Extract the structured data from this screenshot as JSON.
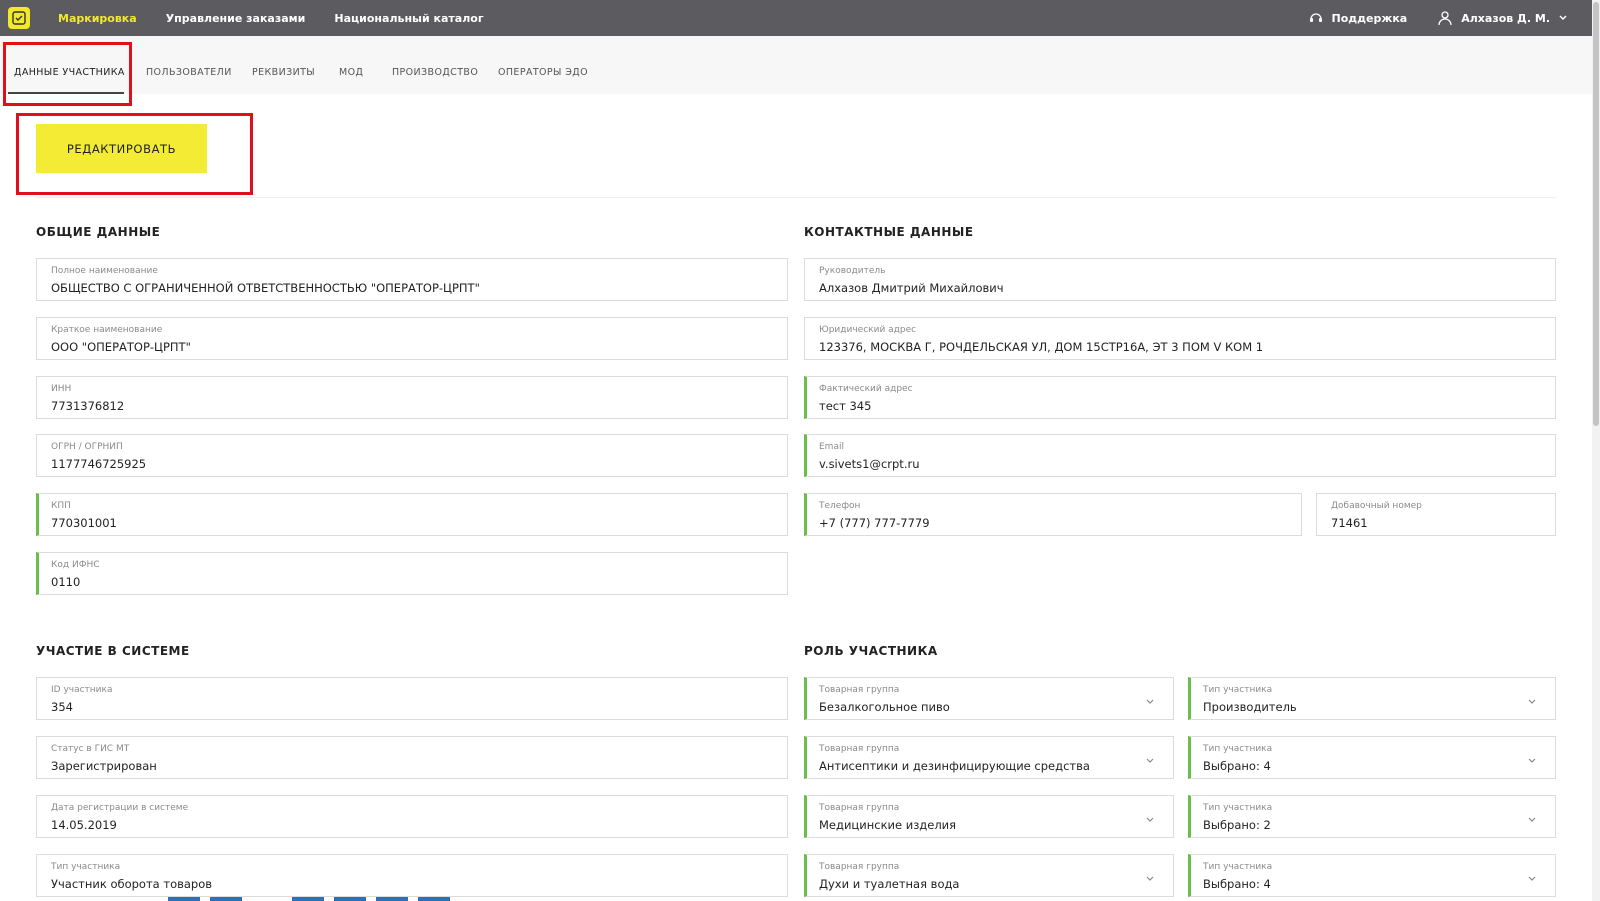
{
  "header": {
    "nav": [
      "Маркировка",
      "Управление заказами",
      "Национальный каталог"
    ],
    "support_label": "Поддержка",
    "user_label": "Алхазов Д. М."
  },
  "tabs": [
    "ДАННЫЕ УЧАСТНИКА",
    "ПОЛЬЗОВАТЕЛИ",
    "РЕКВИЗИТЫ",
    "МОД",
    "ПРОИЗВОДСТВО",
    "ОПЕРАТОРЫ ЭДО"
  ],
  "edit_button": "РЕДАКТИРОВАТЬ",
  "colors": {
    "accent": "#f4ec34",
    "topbar": "#5c5c60",
    "highlight": "#e0101a",
    "valid": "#6bbd4a"
  },
  "general": {
    "title": "ОБЩИЕ ДАННЫЕ",
    "fields": [
      {
        "label": "Полное наименование",
        "value": "ОБЩЕСТВО С ОГРАНИЧЕННОЙ ОТВЕТСТВЕННОСТЬЮ \"ОПЕРАТОР-ЦРПТ\""
      },
      {
        "label": "Краткое наименование",
        "value": "ООО \"ОПЕРАТОР-ЦРПТ\""
      },
      {
        "label": "ИНН",
        "value": "7731376812"
      },
      {
        "label": "ОГРН / ОГРНИП",
        "value": "1177746725925"
      },
      {
        "label": "КПП",
        "value": "770301001"
      },
      {
        "label": "Код ИФНС",
        "value": "0110"
      }
    ]
  },
  "contacts": {
    "title": "КОНТАКТНЫЕ ДАННЫЕ",
    "fields": [
      {
        "label": "Руководитель",
        "value": "Алхазов Дмитрий Михайлович"
      },
      {
        "label": "Юридический адрес",
        "value": "123376, МОСКВА Г, РОЧДЕЛЬСКАЯ УЛ, ДОМ 15СТР16А, ЭТ 3 ПОМ V КОМ 1"
      },
      {
        "label": "Фактический адрес",
        "value": "тест 345"
      },
      {
        "label": "Email",
        "value": "v.sivets1@crpt.ru"
      },
      {
        "label": "Телефон",
        "value": "+7 (777) 777-7779"
      },
      {
        "label": "Добавочный номер",
        "value": "71461"
      }
    ]
  },
  "participation": {
    "title": "УЧАСТИЕ В СИСТЕМЕ",
    "fields": [
      {
        "label": "ID участника",
        "value": "354"
      },
      {
        "label": "Статус в ГИС МТ",
        "value": "Зарегистрирован"
      },
      {
        "label": "Дата регистрации в системе",
        "value": "14.05.2019"
      },
      {
        "label": "Тип участника",
        "value": "Участник оборота товаров"
      }
    ]
  },
  "role": {
    "title": "РОЛЬ УЧАСТНИКА",
    "rows": [
      {
        "group_label": "Товарная группа",
        "group": "Безалкогольное пиво",
        "type_label": "Тип участника",
        "type": "Производитель"
      },
      {
        "group_label": "Товарная группа",
        "group": "Антисептики и дезинфицирующие средства",
        "type_label": "Тип участника",
        "type": "Выбрано: 4"
      },
      {
        "group_label": "Товарная группа",
        "group": "Медицинские изделия",
        "type_label": "Тип участника",
        "type": "Выбрано: 2"
      },
      {
        "group_label": "Товарная группа",
        "group": "Духи и туалетная вода",
        "type_label": "Тип участника",
        "type": "Выбрано: 4"
      }
    ]
  }
}
